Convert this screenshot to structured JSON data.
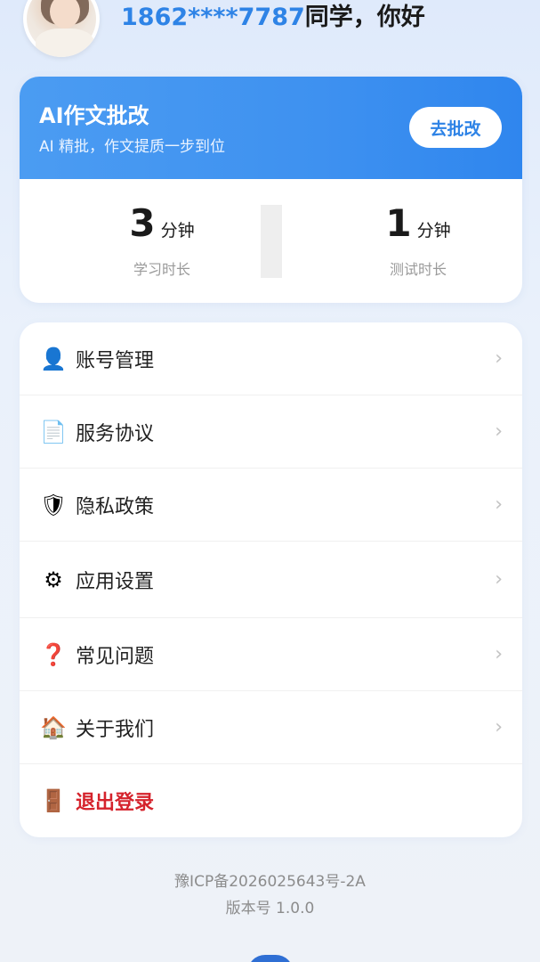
{
  "header": {
    "phone": "1862****7787",
    "greeting_suffix": "同学，你好"
  },
  "ai_card": {
    "title": "AI作文批改",
    "subtitle": "AI 精批，作文提质一步到位",
    "button_label": "去批改",
    "stats": [
      {
        "value": "3",
        "unit": "分钟",
        "label": "学习时长"
      },
      {
        "value": "1",
        "unit": "分钟",
        "label": "测试时长"
      }
    ]
  },
  "menu": {
    "items": [
      {
        "label": "账号管理",
        "icon": "user-icon",
        "glyph": "👤"
      },
      {
        "label": "服务协议",
        "icon": "document-icon",
        "glyph": "📄"
      },
      {
        "label": "隐私政策",
        "icon": "shield-icon",
        "glyph": "🛡"
      },
      {
        "label": "应用设置",
        "icon": "gear-icon",
        "glyph": "⚙"
      },
      {
        "label": "常见问题",
        "icon": "question-icon",
        "glyph": "❓"
      },
      {
        "label": "关于我们",
        "icon": "house-icon",
        "glyph": "🏠"
      },
      {
        "label": "退出登录",
        "icon": "door-icon",
        "glyph": "🚪"
      }
    ],
    "chevron": "›"
  },
  "footer": {
    "icp": "豫ICP备2026025643号-2A",
    "version": "版本号 1.0.0"
  },
  "colors": {
    "accent": "#2e83e6",
    "danger": "#d5232c"
  }
}
